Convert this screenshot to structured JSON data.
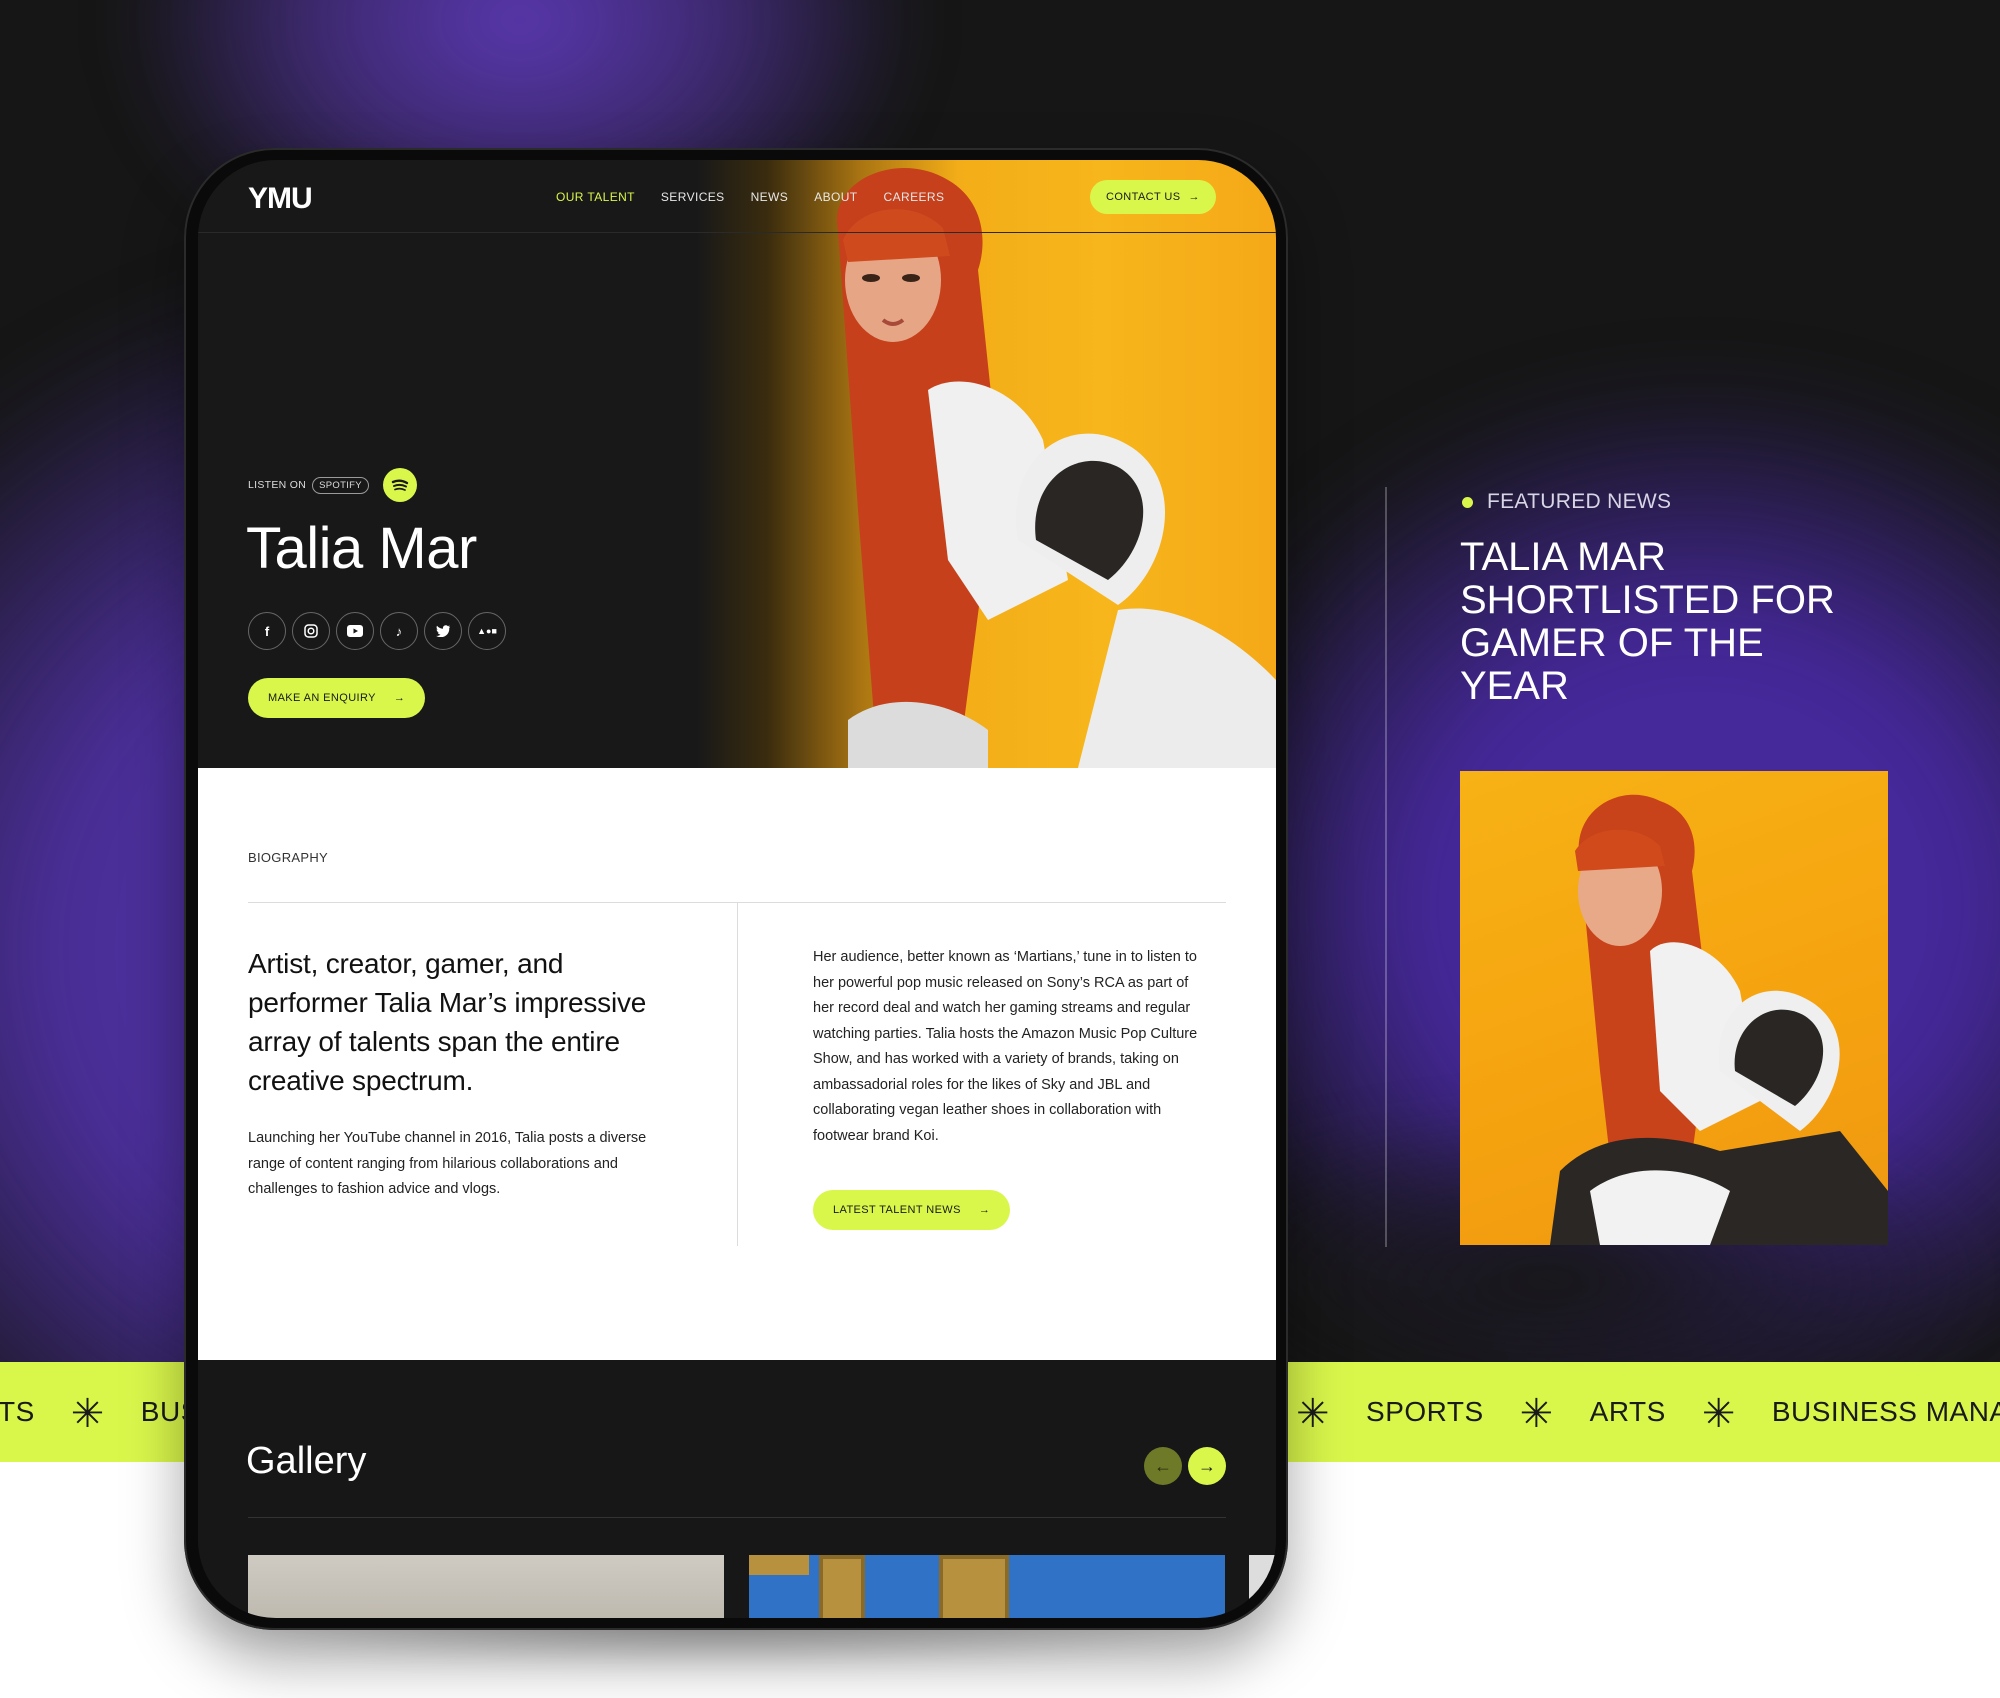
{
  "site": {
    "logo": "YMU",
    "nav": [
      "OUR TALENT",
      "SERVICES",
      "NEWS",
      "ABOUT",
      "CAREERS"
    ],
    "contact_label": "CONTACT US",
    "accent": "#d9f74b"
  },
  "hero": {
    "listen_on": "LISTEN ON",
    "platform": "SPOTIFY",
    "name": "Talia Mar",
    "socials": [
      "facebook-icon",
      "instagram-icon",
      "youtube-icon",
      "tiktok-icon",
      "twitter-icon",
      "amazon-music-icon"
    ],
    "enquiry_label": "MAKE AN ENQUIRY"
  },
  "biography": {
    "label": "BIOGRAPHY",
    "lead": "Artist, creator, gamer, and performer Talia Mar’s impressive array of talents span the entire creative spectrum.",
    "paragraph_left": "Launching her YouTube channel in 2016, Talia posts a diverse range of content ranging from hilarious collaborations and challenges to fashion advice and vlogs.",
    "paragraph_right": "Her audience, better known as ‘Martians,’ tune in to listen to her powerful pop music released on Sony’s RCA as part of her record deal and watch her gaming streams and regular watching parties. Talia hosts the Amazon Music Pop Culture Show, and has worked with a variety of brands, taking on ambassadorial roles for the likes of Sky and JBL and collaborating vegan leather shoes in collaboration with footwear brand Koi.",
    "news_label": "LATEST TALENT NEWS"
  },
  "gallery": {
    "title": "Gallery"
  },
  "featured": {
    "label": "FEATURED NEWS",
    "title": "TALIA MAR SHORTLISTED FOR GAMER OF THE YEAR"
  },
  "marquee": {
    "left": [
      "TS",
      "BUSI"
    ],
    "right": [
      "SPORTS",
      "ARTS",
      "BUSINESS MANAGEMENT"
    ]
  }
}
